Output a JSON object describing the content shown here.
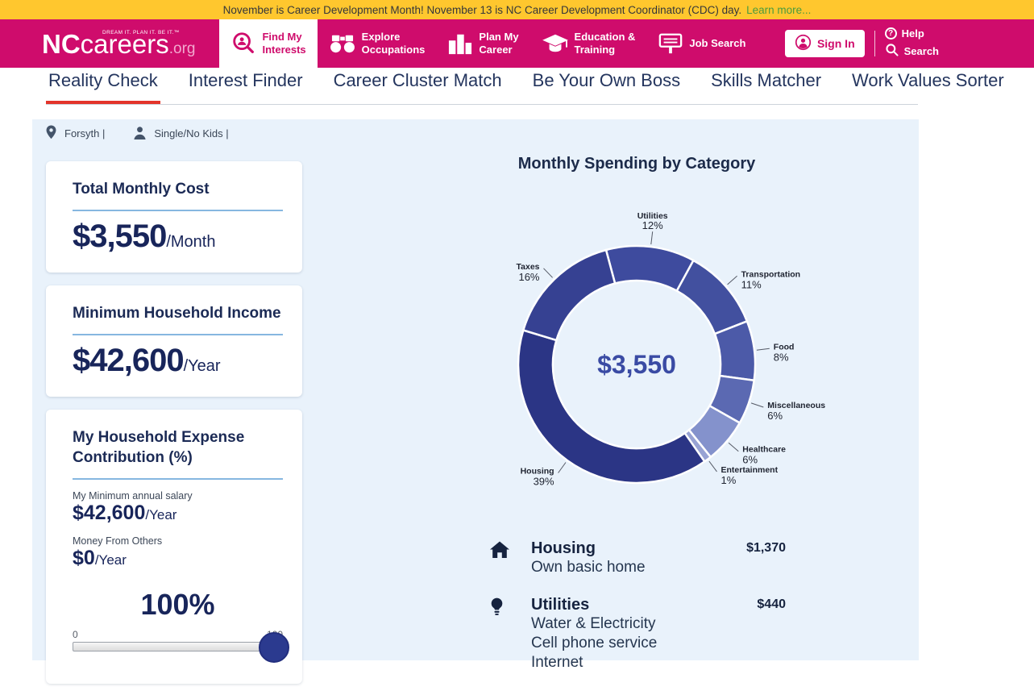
{
  "banner": {
    "text": "November is Career Development Month! November 13 is NC Career Development Coordinator (CDC) day.",
    "link": "Learn more..."
  },
  "header": {
    "logo": {
      "nc": "NC",
      "careers": "careers",
      "org": ".org",
      "tagline": "DREAM IT. PLAN IT. BE IT.™"
    },
    "nav": [
      {
        "label_1": "Find My",
        "label_2": "Interests",
        "active": true
      },
      {
        "label_1": "Explore",
        "label_2": "Occupations",
        "active": false
      },
      {
        "label_1": "Plan My",
        "label_2": "Career",
        "active": false
      },
      {
        "label_1": "Education &",
        "label_2": "Training",
        "active": false
      },
      {
        "label_1": "Job Search",
        "label_2": "",
        "active": false
      }
    ],
    "sign_in": "Sign In",
    "help": "Help",
    "help_glyph": "?",
    "search": "Search"
  },
  "tabs": [
    {
      "label": "Reality Check",
      "active": true
    },
    {
      "label": "Interest Finder",
      "active": false
    },
    {
      "label": "Career Cluster Match",
      "active": false
    },
    {
      "label": "Be Your Own Boss",
      "active": false
    },
    {
      "label": "Skills Matcher",
      "active": false
    },
    {
      "label": "Work Values Sorter",
      "active": false
    }
  ],
  "filters": {
    "location": "Forsyth |",
    "household": "Single/No Kids |"
  },
  "cards": {
    "total_monthly": {
      "title": "Total Monthly Cost",
      "value": "$3,550",
      "unit": "/Month"
    },
    "min_income": {
      "title": "Minimum Household Income",
      "value": "$42,600",
      "unit": "/Year"
    },
    "contribution": {
      "title": "My Household Expense Contribution (%)",
      "salary_label": "My Minimum annual salary",
      "salary_value": "$42,600",
      "salary_unit": "/Year",
      "others_label": "Money From Others",
      "others_value": "$0",
      "others_unit": "/Year",
      "percent": "100%",
      "slider_min": "0",
      "slider_max": "100"
    }
  },
  "chart_data": {
    "type": "pie",
    "donut": true,
    "title": "Monthly Spending by Category",
    "center_label": "$3,550",
    "categories": [
      "Utilities",
      "Transportation",
      "Food",
      "Miscellaneous",
      "Healthcare",
      "Entertainment",
      "Housing",
      "Taxes"
    ],
    "values": [
      12,
      11,
      8,
      6,
      6,
      1,
      39,
      16
    ],
    "colors": [
      "#3e4b9e",
      "#42509f",
      "#4c5aa8",
      "#5b69b2",
      "#8492cc",
      "#98a3d4",
      "#2b3585",
      "#364192"
    ],
    "start_angle_deg": -15,
    "legend": "none",
    "labels": "outside-with-leader-lines"
  },
  "expenses": [
    {
      "name": "Housing",
      "items": [
        "Own basic home"
      ],
      "amount": "$1,370"
    },
    {
      "name": "Utilities",
      "items": [
        "Water & Electricity",
        "Cell phone service",
        "Internet"
      ],
      "amount": "$440"
    }
  ]
}
